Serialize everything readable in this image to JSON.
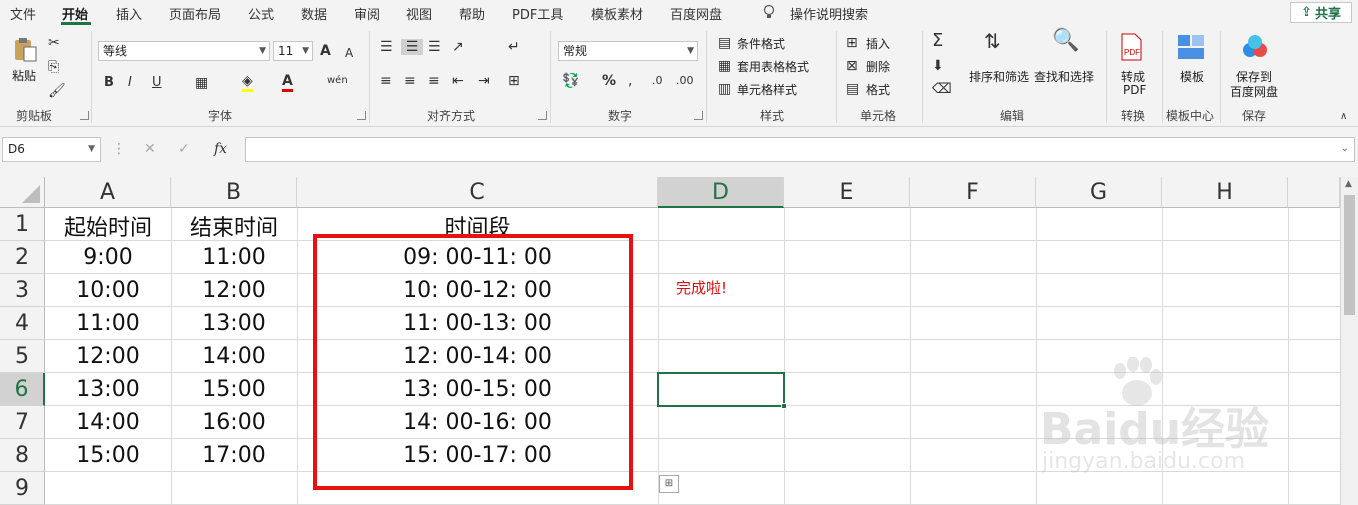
{
  "menu": {
    "items": [
      "文件",
      "开始",
      "插入",
      "页面布局",
      "公式",
      "数据",
      "审阅",
      "视图",
      "帮助",
      "PDF工具",
      "模板素材",
      "百度网盘"
    ],
    "active": "开始",
    "search": "操作说明搜索",
    "share": "共享"
  },
  "ribbon": {
    "clipboard": {
      "label": "剪贴板",
      "paste": "粘贴"
    },
    "font": {
      "label": "字体",
      "name": "等线",
      "size": "11",
      "bold": "B",
      "italic": "I",
      "underline": "U",
      "grow": "A",
      "shrink": "A",
      "phonetic": "wén"
    },
    "alignment": {
      "label": "对齐方式"
    },
    "number": {
      "label": "数字",
      "format": "常规",
      "percent": "%"
    },
    "styles": {
      "label": "样式",
      "conditional": "条件格式",
      "table": "套用表格格式",
      "cell": "单元格样式"
    },
    "cells": {
      "label": "单元格",
      "insert": "插入",
      "delete": "删除",
      "format": "格式"
    },
    "editing": {
      "label": "编辑",
      "sort": "排序和筛选",
      "find": "查找和选择"
    },
    "convert": {
      "label": "转换",
      "pdf_line1": "转成",
      "pdf_line2": "PDF"
    },
    "template": {
      "label": "模板中心",
      "btn": "模板"
    },
    "save": {
      "label": "保存",
      "line1": "保存到",
      "line2": "百度网盘"
    }
  },
  "formula_bar": {
    "name_box": "D6",
    "fx": "fx",
    "value": ""
  },
  "sheet": {
    "columns": [
      "A",
      "B",
      "C",
      "D",
      "E",
      "F",
      "G",
      "H"
    ],
    "rows": [
      "1",
      "2",
      "3",
      "4",
      "5",
      "6",
      "7",
      "8",
      "9"
    ],
    "selected_cell": "D6",
    "headers": [
      "起始时间",
      "结束时间",
      "时间段"
    ],
    "data": [
      [
        "9:00",
        "11:00",
        "09: 00-11: 00"
      ],
      [
        "10:00",
        "12:00",
        "10: 00-12: 00"
      ],
      [
        "11:00",
        "13:00",
        "11: 00-13: 00"
      ],
      [
        "12:00",
        "14:00",
        "12: 00-14: 00"
      ],
      [
        "13:00",
        "15:00",
        "13: 00-15: 00"
      ],
      [
        "14:00",
        "16:00",
        "14: 00-16: 00"
      ],
      [
        "15:00",
        "17:00",
        "15: 00-17: 00"
      ]
    ],
    "note": "完成啦!",
    "highlight_color": "#e81010",
    "accent_color": "#217346"
  },
  "watermark": {
    "brand": "Baidu经验",
    "url": "jingyan.baidu.com"
  }
}
